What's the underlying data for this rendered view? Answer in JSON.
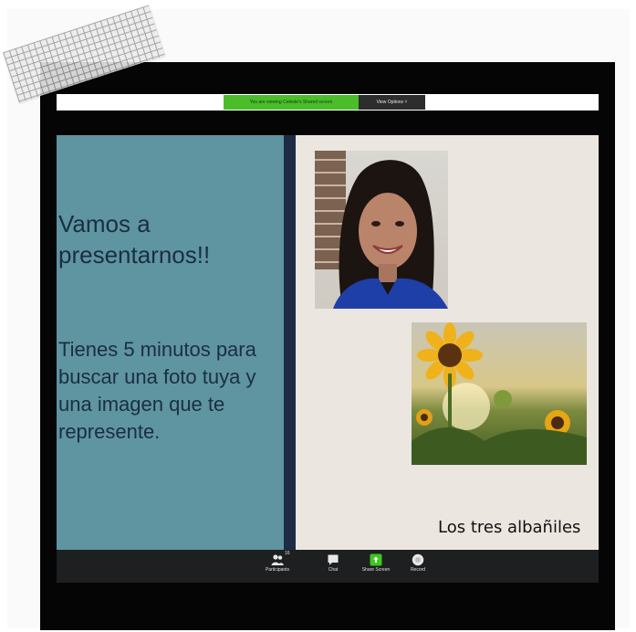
{
  "banner": {
    "sharing_text": "You are viewing Celeste's Shared screen",
    "view_options_label": "View Options ˅"
  },
  "slide": {
    "title": "Vamos a presentarnos!!",
    "body": "Tienes 5 minutos para buscar una foto tuya y una imagen que te represente.",
    "caption": "Los tres albañiles",
    "left_panel_color": "#5f94a1",
    "divider_color": "#1d2b45",
    "background_color": "#ebe6df"
  },
  "toolbar": {
    "participants_label": "Participants",
    "participants_count": "16",
    "chat_label": "Chat",
    "share_label": "Share Screen",
    "record_label": "Record",
    "share_accent": "#3ec71f"
  },
  "icons": [
    "participants-icon",
    "chat-icon",
    "share-screen-icon",
    "record-icon"
  ]
}
